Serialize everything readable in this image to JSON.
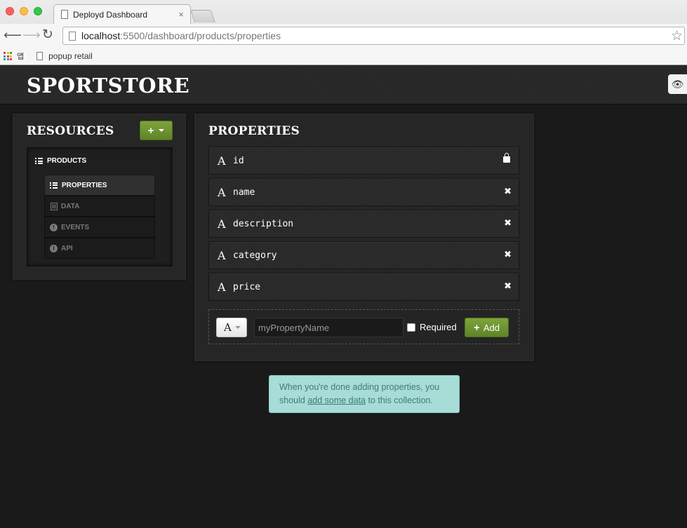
{
  "browser": {
    "tab_title": "Deployd Dashboard",
    "tab_close": "×",
    "url_host": "localhost",
    "url_path": ":5500/dashboard/products/properties",
    "apps_label": "앱",
    "bookmark_popup": "popup retail",
    "icons": {
      "back": "arrow-left-icon",
      "forward": "arrow-right-icon",
      "reload": "reload-icon",
      "star": "star-icon"
    }
  },
  "header": {
    "brand": "SPORTSTORE",
    "eye_icon": "eye-icon"
  },
  "resources": {
    "title": "RESOURCES",
    "add_label": "+",
    "top_item": "PRODUCTS",
    "sub_items": [
      {
        "label": "PROPERTIES",
        "active": true
      },
      {
        "label": "DATA",
        "active": false
      },
      {
        "label": "EVENTS",
        "active": false
      },
      {
        "label": "API",
        "active": false
      }
    ]
  },
  "properties": {
    "title": "PROPERTIES",
    "rows": [
      {
        "type": "A",
        "name": "id",
        "action": "lock"
      },
      {
        "type": "A",
        "name": "name",
        "action": "✖"
      },
      {
        "type": "A",
        "name": "description",
        "action": "✖"
      },
      {
        "type": "A",
        "name": "category",
        "action": "✖"
      },
      {
        "type": "A",
        "name": "price",
        "action": "✖"
      }
    ],
    "new_property": {
      "type": "A",
      "placeholder": "myPropertyName",
      "required_label": "Required",
      "add_label": "Add",
      "add_plus": "+"
    }
  },
  "help": {
    "text_before": "When you're done adding properties, you should ",
    "link_text": "add some data",
    "text_after": " to this collection."
  },
  "colors": {
    "accent_green": "#6a9231",
    "help_bg": "#a8dcd6"
  }
}
